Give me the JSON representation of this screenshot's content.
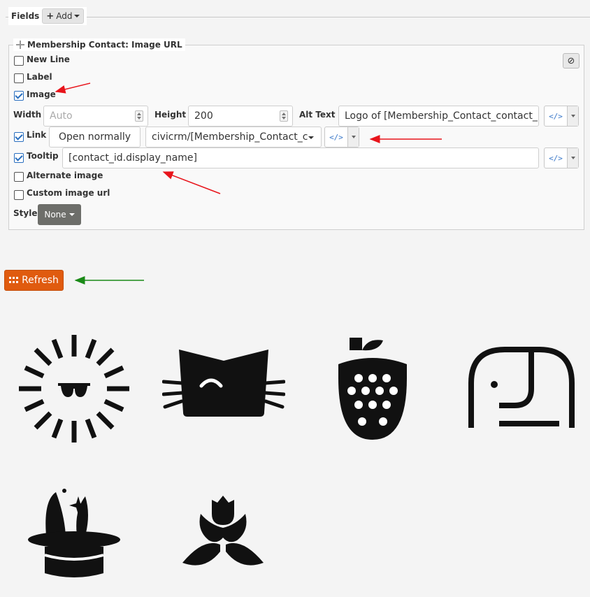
{
  "fields_section": {
    "title": "Fields",
    "add_label": "Add"
  },
  "field_panel": {
    "title": "Membership Contact: Image URL",
    "clear_icon": "⊘",
    "options": {
      "new_line": {
        "label": "New Line",
        "checked": false
      },
      "label": {
        "label": "Label",
        "checked": false
      },
      "image": {
        "label": "Image",
        "checked": true
      },
      "link": {
        "label": "Link",
        "checked": true
      },
      "tooltip": {
        "label": "Tooltip",
        "checked": true
      },
      "alternate_image": {
        "label": "Alternate image",
        "checked": false
      },
      "custom_image_url": {
        "label": "Custom image url",
        "checked": false
      }
    },
    "width": {
      "label": "Width",
      "placeholder": "Auto",
      "value": ""
    },
    "height": {
      "label": "Height",
      "value": "200"
    },
    "alt_text": {
      "label": "Alt Text",
      "value": "Logo of [Membership_Contact_contact_id_"
    },
    "link_target": "Open normally",
    "link_path": "civicrm/[Membership_Contact_c",
    "tooltip_value": "[contact_id.display_name]",
    "style": {
      "label": "Style",
      "value": "None"
    },
    "code_icon": "</>"
  },
  "refresh_label": "Refresh",
  "images": [
    "sun-with-sunglasses-logo",
    "cat-face-logo",
    "raspberry-logo",
    "elephant-logo",
    "magic-hat-rabbit-logo",
    "flower-bouquet-logo"
  ],
  "colors": {
    "accent_orange": "#e05b0f",
    "annotation_red": "#e8141b",
    "annotation_green": "#1a8a17",
    "checkbox_blue": "#2a6fbf"
  }
}
